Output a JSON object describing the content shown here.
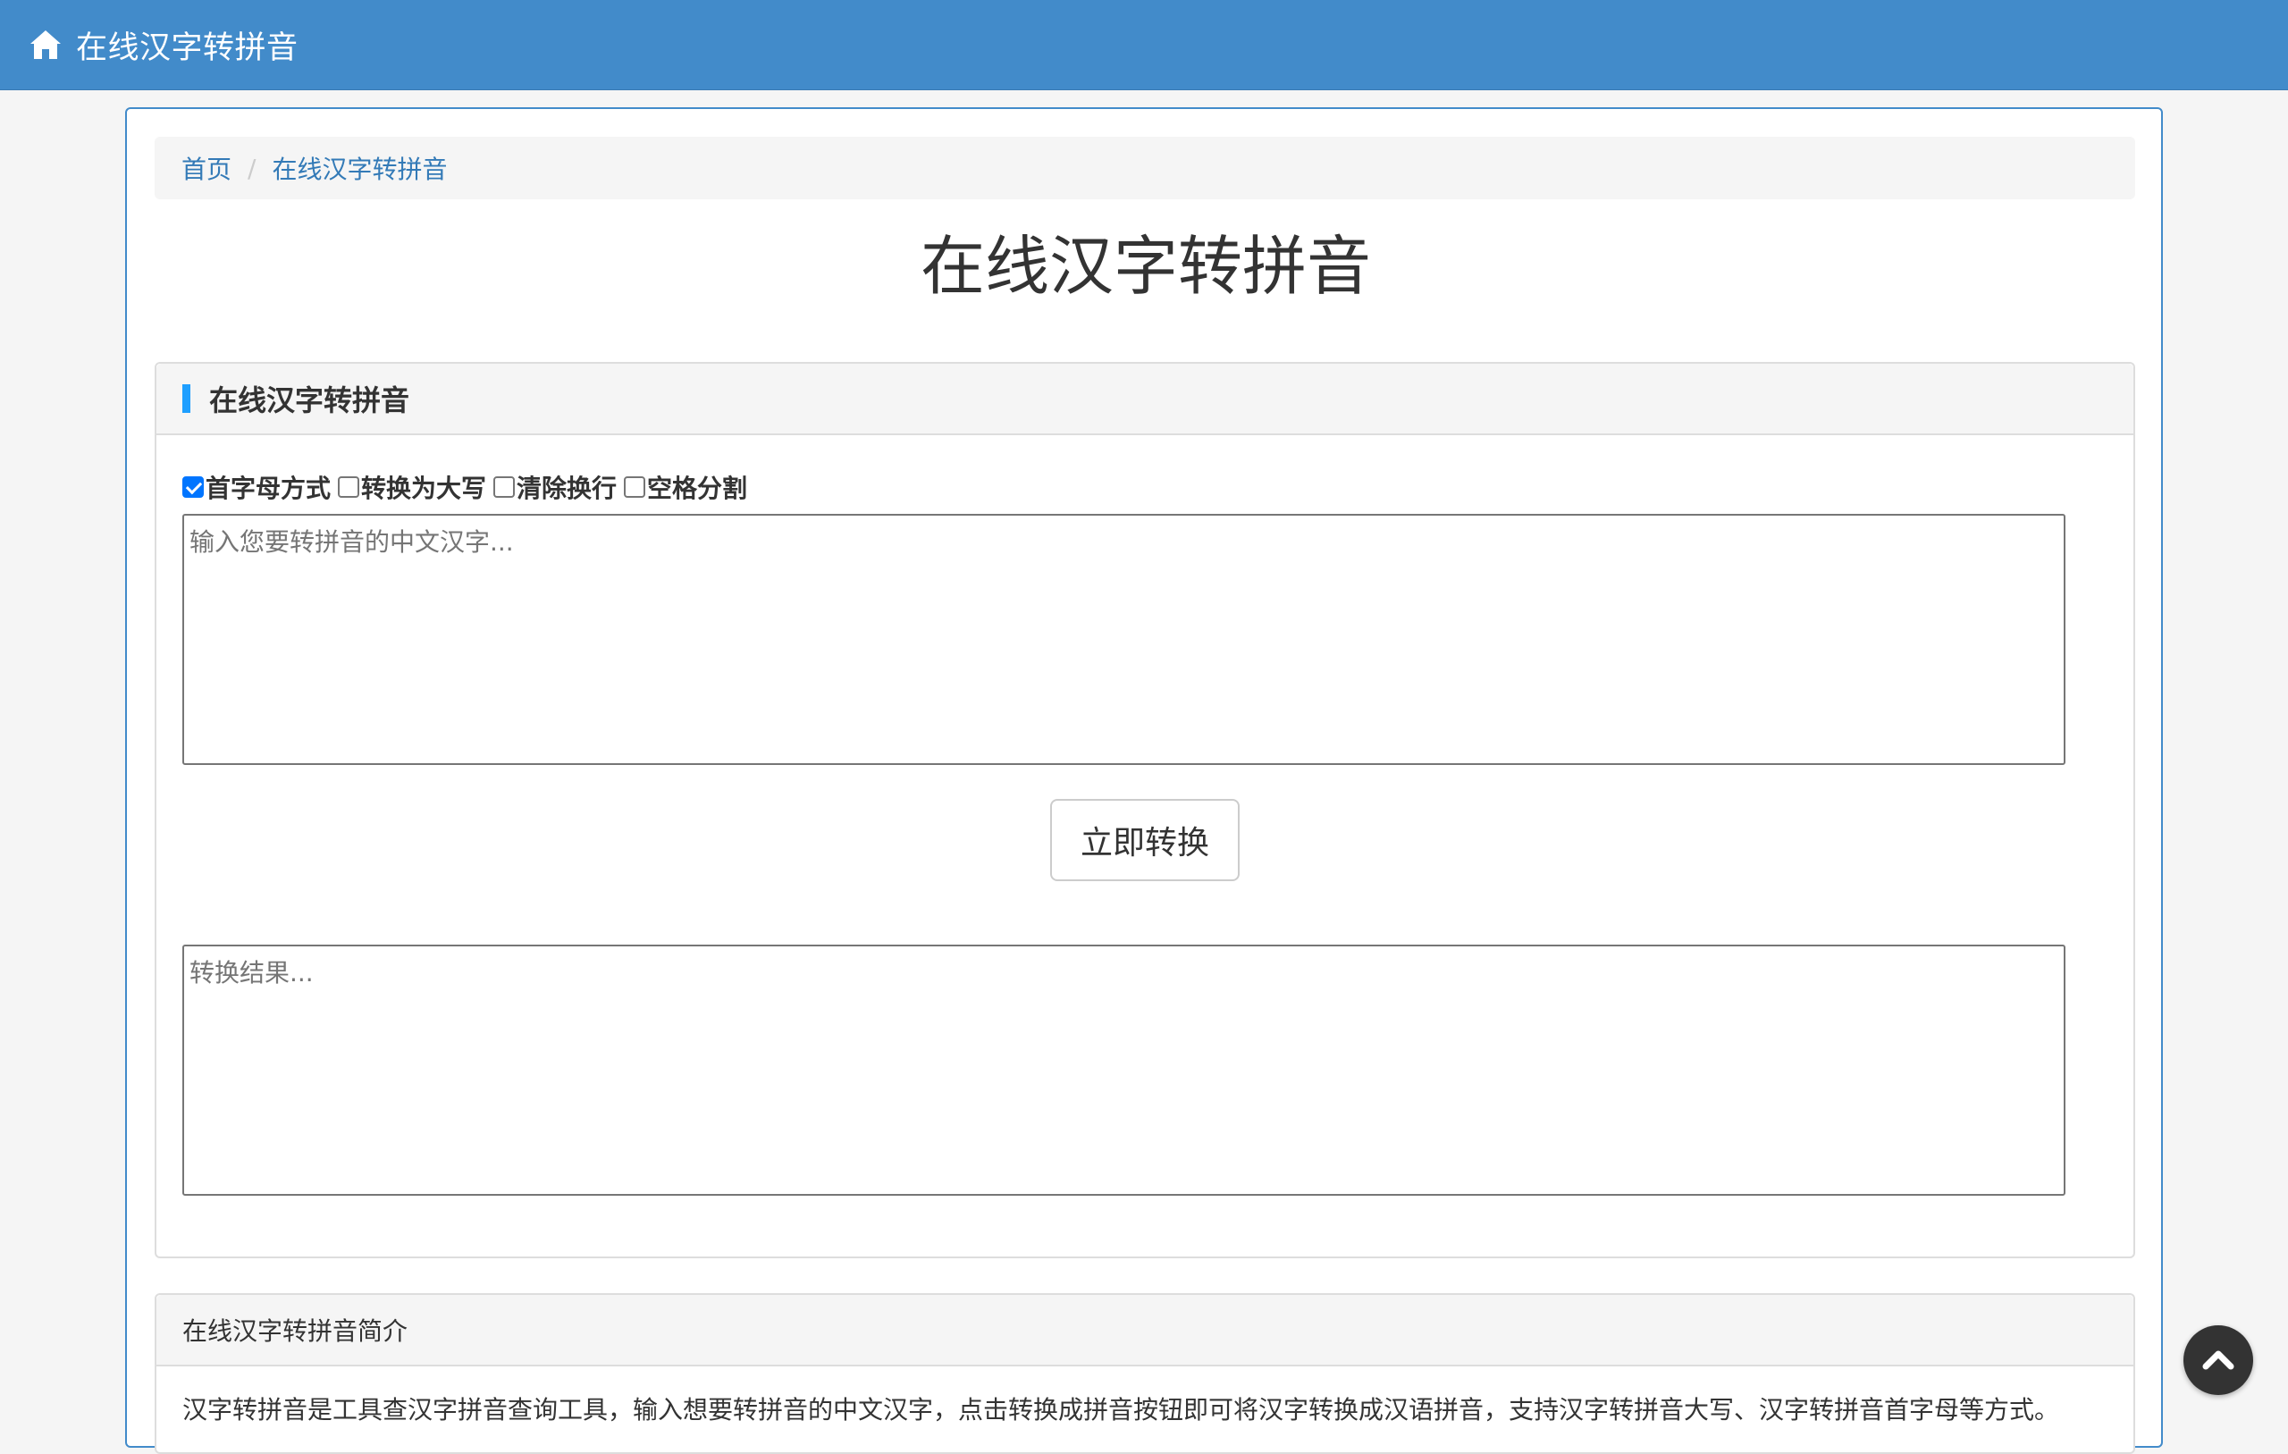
{
  "header": {
    "brand": "在线汉字转拼音",
    "icon": "home-icon"
  },
  "breadcrumb": {
    "home": "首页",
    "separator": "/",
    "current": "在线汉字转拼音"
  },
  "page": {
    "title": "在线汉字转拼音"
  },
  "tool_panel": {
    "title": "在线汉字转拼音",
    "options": [
      {
        "label": "首字母方式",
        "checked": true
      },
      {
        "label": "转换为大写",
        "checked": false
      },
      {
        "label": "清除换行",
        "checked": false
      },
      {
        "label": "空格分割",
        "checked": false
      }
    ],
    "input": {
      "placeholder": "输入您要转拼音的中文汉字...",
      "value": ""
    },
    "convert_label": "立即转换",
    "output": {
      "placeholder": "转换结果...",
      "value": ""
    }
  },
  "intro": {
    "title": "在线汉字转拼音简介",
    "body": "汉字转拼音是工具查汉字拼音查询工具，输入想要转拼音的中文汉字，点击转换成拼音按钮即可将汉字转换成汉语拼音，支持汉字转拼音大写、汉字转拼音首字母等方式。"
  },
  "colors": {
    "header_bg": "#428bca",
    "accent": "#1e9fff",
    "link": "#337ab7"
  },
  "back_to_top": {
    "icon": "chevron-up-icon"
  }
}
